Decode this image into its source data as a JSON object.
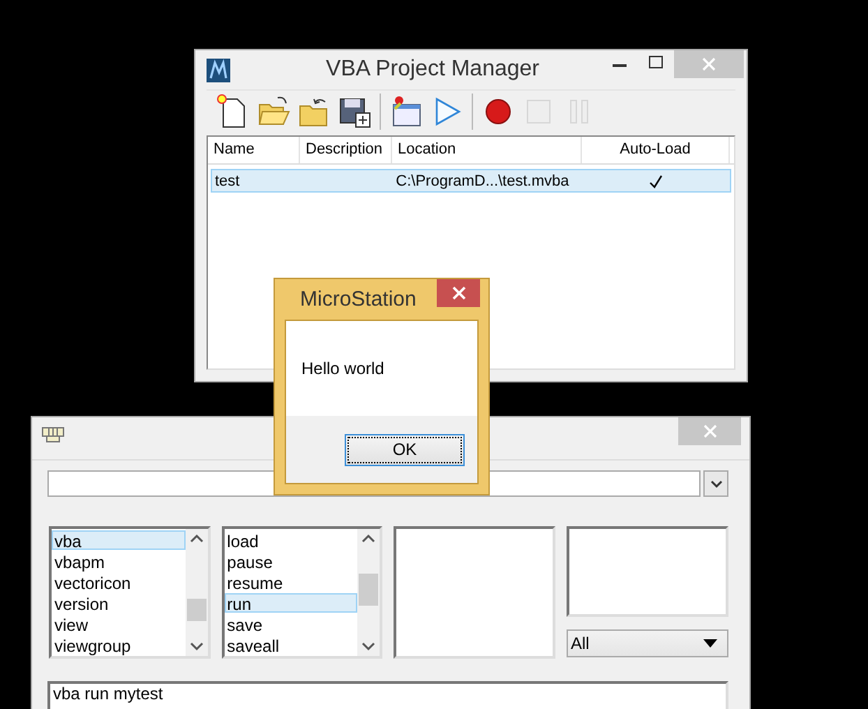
{
  "vba_window": {
    "title": "VBA Project Manager",
    "toolbar": [
      {
        "kind": "new",
        "disabled": false
      },
      {
        "kind": "open",
        "disabled": false
      },
      {
        "kind": "open-back",
        "disabled": false
      },
      {
        "kind": "save",
        "disabled": false
      },
      {
        "kind": "sep"
      },
      {
        "kind": "project",
        "disabled": false
      },
      {
        "kind": "run",
        "disabled": false
      },
      {
        "kind": "sep"
      },
      {
        "kind": "record",
        "disabled": false
      },
      {
        "kind": "stop",
        "disabled": true
      },
      {
        "kind": "pause",
        "disabled": true
      }
    ],
    "columns": [
      "Name",
      "Description",
      "Location",
      "Auto-Load"
    ],
    "rows": [
      {
        "name": "test",
        "location": "C:\\ProgramD...\\test.mvba",
        "auto_load": true,
        "selected": true
      }
    ]
  },
  "keyin_window": {
    "lists": [
      {
        "items": [
          {
            "label": "vba",
            "selected": true
          },
          {
            "label": "vbapm",
            "selected": false
          },
          {
            "label": "vectoricon",
            "selected": false
          },
          {
            "label": "version",
            "selected": false
          },
          {
            "label": "view",
            "selected": false
          },
          {
            "label": "viewgroup",
            "selected": false
          }
        ]
      },
      {
        "items": [
          {
            "label": "load",
            "selected": false
          },
          {
            "label": "pause",
            "selected": false
          },
          {
            "label": "resume",
            "selected": false
          },
          {
            "label": "run",
            "selected": true
          },
          {
            "label": "save",
            "selected": false
          },
          {
            "label": "saveall",
            "selected": false
          }
        ]
      }
    ],
    "filter": "All",
    "history": [
      "vba run mytest"
    ]
  },
  "message_box": {
    "title": "MicroStation",
    "message": "Hello world",
    "buttons": [
      "OK"
    ]
  }
}
